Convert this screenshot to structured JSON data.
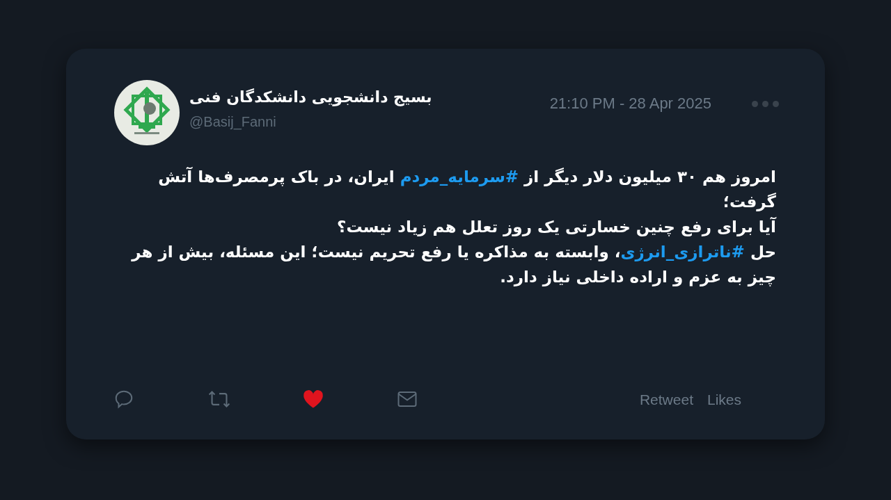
{
  "tweet": {
    "author": {
      "name": "بسیج دانشجویی دانشکدگان فنی",
      "handle": "@Basij_Fanni"
    },
    "timestamp": "21:10 PM - 28 Apr 2025",
    "paragraphs": [
      [
        {
          "kind": "text",
          "text": "امروز هم ۳۰ میلیون دلار دیگر از "
        },
        {
          "kind": "hashtag",
          "text": "#سرمایه_مردم"
        },
        {
          "kind": "text",
          "text": " ایران، در باک پرمصرف‌ها آتش گرفت؛"
        }
      ],
      [
        {
          "kind": "text",
          "text": "آیا برای رفع چنین خسارتی یک روز تعلل هم زیاد نیست؟"
        }
      ],
      [
        {
          "kind": "text",
          "text": "حل "
        },
        {
          "kind": "hashtag",
          "text": "#ناترازی_انرژی"
        },
        {
          "kind": "text",
          "text": "، وابسته به مذاکره یا رفع تحریم نیست؛ این مسئله، بیش از هر چیز به عزم و اراده داخلی نیاز دارد."
        }
      ]
    ],
    "liked": true,
    "retweet_label": "Retweet",
    "likes_label": "Likes"
  }
}
